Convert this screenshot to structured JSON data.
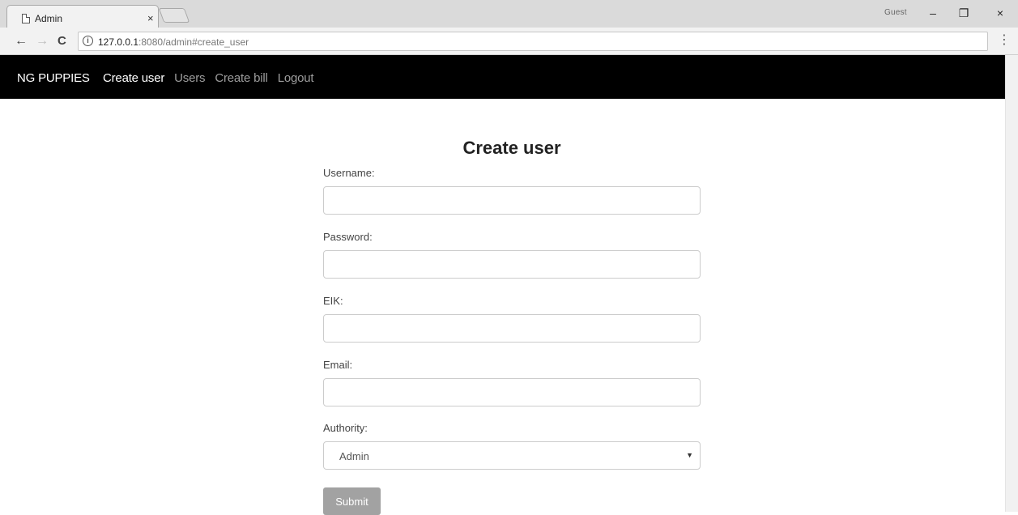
{
  "browser": {
    "tab_title": "Admin",
    "tab_close": "×",
    "profile_label": "Guest",
    "minimize": "–",
    "restore": "❐",
    "close": "×",
    "url_host": "127.0.0.1",
    "url_rest": ":8080/admin#create_user",
    "icons": {
      "back": "←",
      "forward": "→",
      "reload": "C",
      "info": "i",
      "menu": "⋮"
    }
  },
  "navbar": {
    "brand": "NG PUPPIES",
    "links": [
      {
        "label": "Create user",
        "active": true
      },
      {
        "label": "Users",
        "active": false
      },
      {
        "label": "Create bill",
        "active": false
      },
      {
        "label": "Logout",
        "active": false
      }
    ]
  },
  "form": {
    "title": "Create user",
    "username_label": "Username:",
    "username_value": "",
    "password_label": "Password:",
    "password_value": "",
    "eik_label": "EIK:",
    "eik_value": "",
    "email_label": "Email:",
    "email_value": "",
    "authority_label": "Authority:",
    "authority_selected": "Admin",
    "select_arrow": "▼",
    "submit_label": "Submit"
  },
  "colors": {
    "navbar_bg": "#000000",
    "nav_active": "#ffffff",
    "nav_inactive": "#9d9d9d",
    "submit_bg": "#a2a2a2"
  }
}
